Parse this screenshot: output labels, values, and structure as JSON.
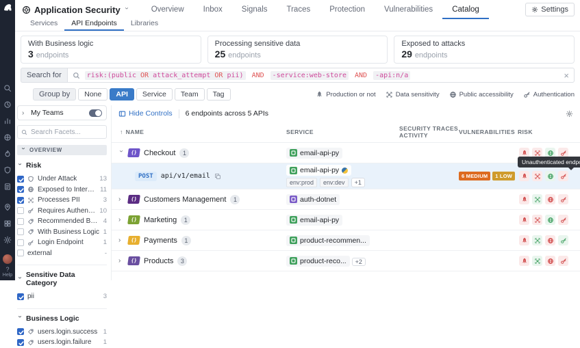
{
  "brand": {
    "name": "Datadog"
  },
  "topnav": {
    "product": "Application Security",
    "items": [
      {
        "label": "Overview",
        "active": false
      },
      {
        "label": "Inbox",
        "active": false
      },
      {
        "label": "Signals",
        "active": false
      },
      {
        "label": "Traces",
        "active": false
      },
      {
        "label": "Protection",
        "active": false
      },
      {
        "label": "Vulnerabilities",
        "active": false
      },
      {
        "label": "Catalog",
        "active": true
      }
    ],
    "settings_label": "Settings"
  },
  "subnav": {
    "items": [
      {
        "label": "Services",
        "active": false
      },
      {
        "label": "API Endpoints",
        "active": true
      },
      {
        "label": "Libraries",
        "active": false
      }
    ]
  },
  "cards": [
    {
      "title": "With Business logic",
      "value": "3",
      "unit": "endpoints"
    },
    {
      "title": "Processing sensitive data",
      "value": "25",
      "unit": "endpoints"
    },
    {
      "title": "Exposed to attacks",
      "value": "29",
      "unit": "endpoints"
    }
  ],
  "search": {
    "label": "Search for",
    "token_groups": [
      {
        "bg": true,
        "parts": [
          {
            "t": "risk:(public ",
            "c": "pink"
          },
          {
            "t": "OR",
            "c": "red"
          },
          {
            "t": " attack_attempt ",
            "c": "pink"
          },
          {
            "t": "OR",
            "c": "red"
          },
          {
            "t": " pii)",
            "c": "pink"
          }
        ]
      },
      {
        "bg": false,
        "parts": [
          {
            "t": "AND",
            "c": "red"
          }
        ]
      },
      {
        "bg": true,
        "parts": [
          {
            "t": "-service:web-store",
            "c": "pink"
          }
        ]
      },
      {
        "bg": false,
        "parts": [
          {
            "t": "AND",
            "c": "red"
          }
        ]
      },
      {
        "bg": true,
        "parts": [
          {
            "t": "-api:n/a",
            "c": "pink"
          }
        ]
      }
    ]
  },
  "groupby": {
    "label": "Group by",
    "options": [
      "None",
      "API",
      "Service",
      "Team",
      "Tag"
    ],
    "active": "API"
  },
  "legend": [
    {
      "icon": "rocket",
      "label": "Production or not"
    },
    {
      "icon": "pii",
      "label": "Data sensitivity"
    },
    {
      "icon": "globe",
      "label": "Public accessibility"
    },
    {
      "icon": "key",
      "label": "Authentication"
    }
  ],
  "facets": {
    "my_teams": "My Teams",
    "search_placeholder": "Search Facets...",
    "overview": "OVERVIEW",
    "groups": [
      {
        "title": "Risk",
        "bordered": false,
        "items": [
          {
            "icon": "shield",
            "label": "Under Attack",
            "count": "13",
            "checked": true
          },
          {
            "icon": "globe",
            "label": "Exposed to Internet",
            "count": "11",
            "checked": true
          },
          {
            "icon": "pii",
            "label": "Processes PII",
            "count": "3",
            "checked": true
          },
          {
            "icon": "key",
            "label": "Requires Authenticati...",
            "count": "10",
            "checked": false
          },
          {
            "icon": "tag",
            "label": "Recommended Busin...",
            "count": "4",
            "checked": false
          },
          {
            "icon": "tag",
            "label": "With Business Logic",
            "count": "1",
            "checked": false
          },
          {
            "icon": "key",
            "label": "Login Endpoint",
            "count": "1",
            "checked": false
          },
          {
            "icon": "",
            "label": "external",
            "count": "-",
            "checked": false
          }
        ]
      },
      {
        "title": "Sensitive Data Category",
        "bordered": true,
        "items": [
          {
            "icon": "",
            "label": "pii",
            "count": "3",
            "checked": true
          }
        ]
      },
      {
        "title": "Business Logic",
        "bordered": true,
        "items": [
          {
            "icon": "tag",
            "label": "users.login.success",
            "count": "1",
            "checked": true
          },
          {
            "icon": "tag",
            "label": "users.login.failure",
            "count": "1",
            "checked": true
          }
        ]
      }
    ]
  },
  "table": {
    "hide_controls": "Hide Controls",
    "summary": "6 endpoints across 5 APIs",
    "columns": [
      "NAME",
      "SERVICE",
      "SECURITY TRACES ACTIVITY",
      "VULNERABILITIES",
      "RISK"
    ],
    "risk_order": [
      "rocket",
      "pii",
      "globe",
      "key"
    ],
    "rows": [
      {
        "kind": "group",
        "chevron": "down",
        "api": {
          "label": "Checkout",
          "count": "1",
          "color": "#6e55c9"
        },
        "service": {
          "name": "email-api-py",
          "color": "#3fa05c"
        },
        "risk": {
          "rocket": "red",
          "pii": "red",
          "globe": "green",
          "key": "red"
        }
      },
      {
        "kind": "endpoint",
        "selected": true,
        "method": "POST",
        "path": "api/v1/email",
        "service": {
          "name": "email-api-py",
          "color": "#3fa05c",
          "python": true
        },
        "tags": [
          "env:prod",
          "env:dev"
        ],
        "tags_more": "+1",
        "vulns": [
          {
            "label": "6 MEDIUM",
            "bg": "#dd6b20"
          },
          {
            "label": "1 LOW",
            "bg": "#cf9b2c"
          }
        ],
        "risk": {
          "rocket": "red",
          "pii": "red",
          "globe": "green",
          "key": "red"
        },
        "tooltip": "Unauthenticated endpoint"
      },
      {
        "kind": "group",
        "chevron": "right",
        "api": {
          "label": "Customers Management",
          "count": "1",
          "color": "#5b2c83"
        },
        "service": {
          "name": "auth-dotnet",
          "color": "#7a5bc7"
        },
        "risk": {
          "rocket": "red",
          "pii": "green",
          "globe": "red",
          "key": "red"
        }
      },
      {
        "kind": "group",
        "chevron": "right",
        "api": {
          "label": "Marketing",
          "count": "1",
          "color": "#7ca233"
        },
        "service": {
          "name": "email-api-py",
          "color": "#3fa05c"
        },
        "risk": {
          "rocket": "red",
          "pii": "red",
          "globe": "green",
          "key": "red"
        }
      },
      {
        "kind": "group",
        "chevron": "right",
        "api": {
          "label": "Payments",
          "count": "1",
          "color": "#e7af2f"
        },
        "service": {
          "name": "product-recommen...",
          "color": "#3fa05c"
        },
        "risk": {
          "rocket": "red",
          "pii": "green",
          "globe": "red",
          "key": "green"
        }
      },
      {
        "kind": "group",
        "chevron": "right",
        "api": {
          "label": "Products",
          "count": "3",
          "color": "#6a4fa0"
        },
        "service": {
          "name": "product-reco...",
          "color": "#3fa05c",
          "more": "+2"
        },
        "risk": {
          "rocket": "red",
          "pii": "green",
          "globe": "red",
          "key": "red"
        }
      }
    ]
  },
  "sidebar": {
    "icons": [
      "search",
      "clock",
      "bars",
      "globe2",
      "flame",
      "shield",
      "doc"
    ],
    "icons2": [
      "pin",
      "grid2",
      "gear"
    ],
    "help": "Help"
  },
  "colors": {
    "accent_blue": "#2f6fc4",
    "risk_red": "#cf4545",
    "risk_green": "#3f9f5f",
    "query_pink": "#cf4a9b",
    "query_red": "#df5454",
    "vuln_medium": "#dd6b20",
    "vuln_low": "#cf9b2c"
  }
}
